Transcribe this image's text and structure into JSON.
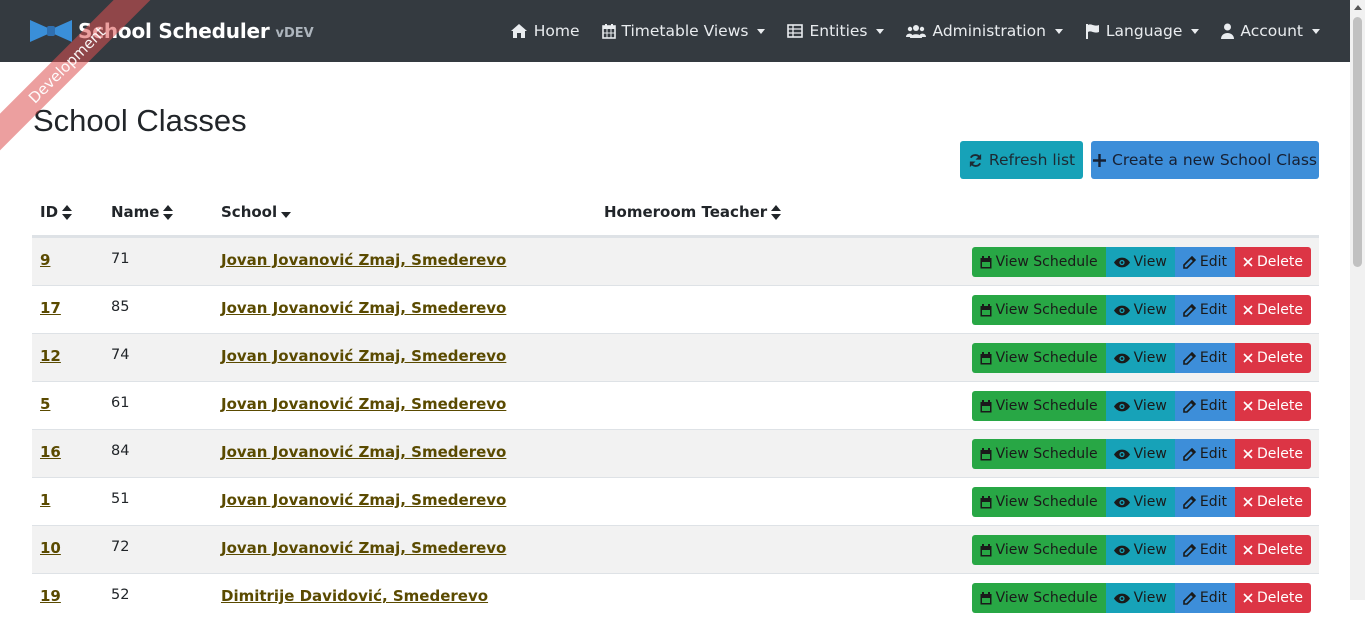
{
  "navbar": {
    "brand": "School Scheduler",
    "version": "vDEV",
    "items": [
      {
        "label": "Home",
        "icon": "home-icon",
        "dropdown": false
      },
      {
        "label": "Timetable Views",
        "icon": "calendar-icon",
        "dropdown": true
      },
      {
        "label": "Entities",
        "icon": "table-icon",
        "dropdown": true
      },
      {
        "label": "Administration",
        "icon": "users-icon",
        "dropdown": true
      },
      {
        "label": "Language",
        "icon": "flag-icon",
        "dropdown": true
      },
      {
        "label": "Account",
        "icon": "user-icon",
        "dropdown": true
      }
    ]
  },
  "ribbon": "Development",
  "page": {
    "title": "School Classes",
    "refresh_label": "Refresh list",
    "create_label": "Create a new School Class"
  },
  "table": {
    "headers": {
      "id": "ID",
      "name": "Name",
      "school": "School",
      "teacher": "Homeroom Teacher"
    },
    "rows": [
      {
        "id": "9",
        "name": "71",
        "school": "Jovan Jovanović Zmaj, Smederevo",
        "teacher": ""
      },
      {
        "id": "17",
        "name": "85",
        "school": "Jovan Jovanović Zmaj, Smederevo",
        "teacher": ""
      },
      {
        "id": "12",
        "name": "74",
        "school": "Jovan Jovanović Zmaj, Smederevo",
        "teacher": ""
      },
      {
        "id": "5",
        "name": "61",
        "school": "Jovan Jovanović Zmaj, Smederevo",
        "teacher": ""
      },
      {
        "id": "16",
        "name": "84",
        "school": "Jovan Jovanović Zmaj, Smederevo",
        "teacher": ""
      },
      {
        "id": "1",
        "name": "51",
        "school": "Jovan Jovanović Zmaj, Smederevo",
        "teacher": ""
      },
      {
        "id": "10",
        "name": "72",
        "school": "Jovan Jovanović Zmaj, Smederevo",
        "teacher": ""
      },
      {
        "id": "19",
        "name": "52",
        "school": "Dimitrije Davidović, Smederevo",
        "teacher": ""
      }
    ],
    "actions": {
      "schedule": "View Schedule",
      "view": "View",
      "edit": "Edit",
      "delete": "Delete"
    }
  },
  "colors": {
    "navbar": "#343a40",
    "info": "#17a2b8",
    "primary": "#3d8ed9",
    "success": "#28a745",
    "danger": "#dc3545",
    "link": "#5a4a00"
  }
}
